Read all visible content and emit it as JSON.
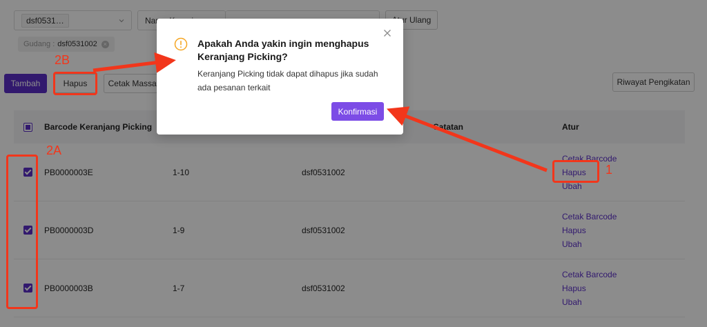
{
  "filters": {
    "warehouse_select_value": "dsf0531…",
    "field_select_placeholder": "Nama Keranjang",
    "reset_button": "Atur Ulang",
    "active_tag_key": "Gudang :",
    "active_tag_value": "dsf0531002"
  },
  "toolbar": {
    "add_button": "Tambah",
    "delete_button": "Hapus",
    "bulk_print_button": "Cetak Massal",
    "history_button": "Riwayat Pengikatan"
  },
  "table": {
    "headers": [
      "Barcode Keranjang Picking",
      "",
      "",
      "Catatan",
      "Atur"
    ],
    "rows": [
      {
        "barcode": "PB0000003E",
        "range": "1-10",
        "warehouse": "dsf0531002",
        "actions": [
          "Cetak Barcode",
          "Hapus",
          "Ubah"
        ]
      },
      {
        "barcode": "PB0000003D",
        "range": "1-9",
        "warehouse": "dsf0531002",
        "actions": [
          "Cetak Barcode",
          "Hapus",
          "Ubah"
        ]
      },
      {
        "barcode": "PB0000003B",
        "range": "1-7",
        "warehouse": "dsf0531002",
        "actions": [
          "Cetak Barcode",
          "Hapus",
          "Ubah"
        ]
      }
    ]
  },
  "modal": {
    "title": "Apakah Anda yakin ingin menghapus Keranjang Picking?",
    "message": "Keranjang Picking tidak dapat dihapus jika sudah ada pesanan terkait",
    "confirm_button": "Konfirmasi"
  },
  "annotations": {
    "label_1": "1",
    "label_2a": "2A",
    "label_2b": "2B"
  },
  "colors": {
    "primary": "#5b2fc9",
    "confirm": "#7c4ce6",
    "annotation": "#f2361b",
    "warning": "#f5a623"
  }
}
